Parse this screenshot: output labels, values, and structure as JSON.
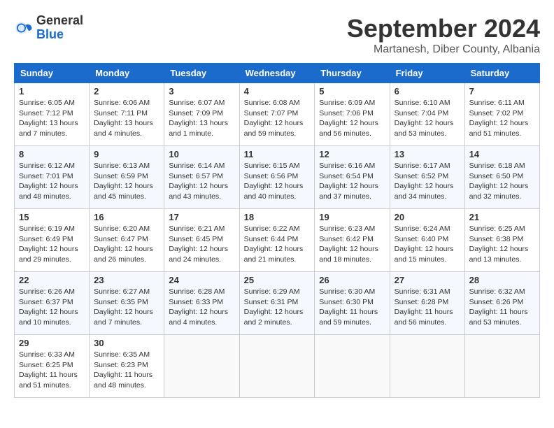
{
  "header": {
    "logo_general": "General",
    "logo_blue": "Blue",
    "month_title": "September 2024",
    "location": "Martanesh, Diber County, Albania"
  },
  "days_of_week": [
    "Sunday",
    "Monday",
    "Tuesday",
    "Wednesday",
    "Thursday",
    "Friday",
    "Saturday"
  ],
  "weeks": [
    [
      {
        "day": "1",
        "sunrise": "6:05 AM",
        "sunset": "7:12 PM",
        "daylight": "13 hours and 7 minutes."
      },
      {
        "day": "2",
        "sunrise": "6:06 AM",
        "sunset": "7:11 PM",
        "daylight": "13 hours and 4 minutes."
      },
      {
        "day": "3",
        "sunrise": "6:07 AM",
        "sunset": "7:09 PM",
        "daylight": "13 hours and 1 minute."
      },
      {
        "day": "4",
        "sunrise": "6:08 AM",
        "sunset": "7:07 PM",
        "daylight": "12 hours and 59 minutes."
      },
      {
        "day": "5",
        "sunrise": "6:09 AM",
        "sunset": "7:06 PM",
        "daylight": "12 hours and 56 minutes."
      },
      {
        "day": "6",
        "sunrise": "6:10 AM",
        "sunset": "7:04 PM",
        "daylight": "12 hours and 53 minutes."
      },
      {
        "day": "7",
        "sunrise": "6:11 AM",
        "sunset": "7:02 PM",
        "daylight": "12 hours and 51 minutes."
      }
    ],
    [
      {
        "day": "8",
        "sunrise": "6:12 AM",
        "sunset": "7:01 PM",
        "daylight": "12 hours and 48 minutes."
      },
      {
        "day": "9",
        "sunrise": "6:13 AM",
        "sunset": "6:59 PM",
        "daylight": "12 hours and 45 minutes."
      },
      {
        "day": "10",
        "sunrise": "6:14 AM",
        "sunset": "6:57 PM",
        "daylight": "12 hours and 43 minutes."
      },
      {
        "day": "11",
        "sunrise": "6:15 AM",
        "sunset": "6:56 PM",
        "daylight": "12 hours and 40 minutes."
      },
      {
        "day": "12",
        "sunrise": "6:16 AM",
        "sunset": "6:54 PM",
        "daylight": "12 hours and 37 minutes."
      },
      {
        "day": "13",
        "sunrise": "6:17 AM",
        "sunset": "6:52 PM",
        "daylight": "12 hours and 34 minutes."
      },
      {
        "day": "14",
        "sunrise": "6:18 AM",
        "sunset": "6:50 PM",
        "daylight": "12 hours and 32 minutes."
      }
    ],
    [
      {
        "day": "15",
        "sunrise": "6:19 AM",
        "sunset": "6:49 PM",
        "daylight": "12 hours and 29 minutes."
      },
      {
        "day": "16",
        "sunrise": "6:20 AM",
        "sunset": "6:47 PM",
        "daylight": "12 hours and 26 minutes."
      },
      {
        "day": "17",
        "sunrise": "6:21 AM",
        "sunset": "6:45 PM",
        "daylight": "12 hours and 24 minutes."
      },
      {
        "day": "18",
        "sunrise": "6:22 AM",
        "sunset": "6:44 PM",
        "daylight": "12 hours and 21 minutes."
      },
      {
        "day": "19",
        "sunrise": "6:23 AM",
        "sunset": "6:42 PM",
        "daylight": "12 hours and 18 minutes."
      },
      {
        "day": "20",
        "sunrise": "6:24 AM",
        "sunset": "6:40 PM",
        "daylight": "12 hours and 15 minutes."
      },
      {
        "day": "21",
        "sunrise": "6:25 AM",
        "sunset": "6:38 PM",
        "daylight": "12 hours and 13 minutes."
      }
    ],
    [
      {
        "day": "22",
        "sunrise": "6:26 AM",
        "sunset": "6:37 PM",
        "daylight": "12 hours and 10 minutes."
      },
      {
        "day": "23",
        "sunrise": "6:27 AM",
        "sunset": "6:35 PM",
        "daylight": "12 hours and 7 minutes."
      },
      {
        "day": "24",
        "sunrise": "6:28 AM",
        "sunset": "6:33 PM",
        "daylight": "12 hours and 4 minutes."
      },
      {
        "day": "25",
        "sunrise": "6:29 AM",
        "sunset": "6:31 PM",
        "daylight": "12 hours and 2 minutes."
      },
      {
        "day": "26",
        "sunrise": "6:30 AM",
        "sunset": "6:30 PM",
        "daylight": "11 hours and 59 minutes."
      },
      {
        "day": "27",
        "sunrise": "6:31 AM",
        "sunset": "6:28 PM",
        "daylight": "11 hours and 56 minutes."
      },
      {
        "day": "28",
        "sunrise": "6:32 AM",
        "sunset": "6:26 PM",
        "daylight": "11 hours and 53 minutes."
      }
    ],
    [
      {
        "day": "29",
        "sunrise": "6:33 AM",
        "sunset": "6:25 PM",
        "daylight": "11 hours and 51 minutes."
      },
      {
        "day": "30",
        "sunrise": "6:35 AM",
        "sunset": "6:23 PM",
        "daylight": "11 hours and 48 minutes."
      },
      null,
      null,
      null,
      null,
      null
    ]
  ]
}
